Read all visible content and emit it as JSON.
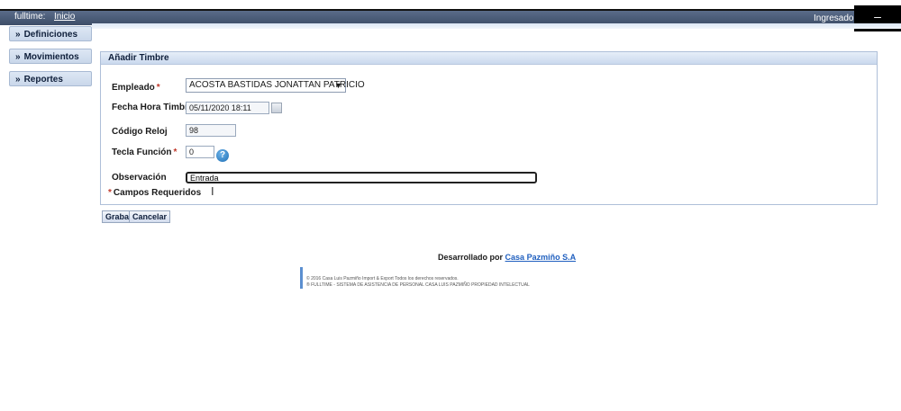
{
  "topbar": {
    "app_label": "fulltime:",
    "home_link": "Inicio",
    "logged_label": "Ingresado co",
    "overlay_glyph": "–"
  },
  "sidebar": {
    "items": [
      {
        "label": "Definiciones",
        "icon": "double-chevron-right-icon"
      },
      {
        "label": "Movimientos",
        "icon": "double-chevron-right-icon"
      },
      {
        "label": "Reportes",
        "icon": "double-chevron-right-icon"
      }
    ]
  },
  "form": {
    "title": "Añadir Timbre",
    "empleado_label": "Empleado",
    "empleado_value": "ACOSTA BASTIDAS JONATTAN PATRICIO",
    "fecha_label": "Fecha Hora Timbre",
    "fecha_value": "05/11/2020 18:11",
    "codigo_label": "Código Reloj",
    "codigo_value": "98",
    "tecla_label": "Tecla Función",
    "tecla_value": "0",
    "observacion_label": "Observación",
    "observacion_value": "Entrada",
    "required_marker": "*",
    "required_note": "Campos Requeridos",
    "help_glyph": "?",
    "cursor_glyph": "I"
  },
  "buttons": {
    "save": "Grabar",
    "cancel": "Cancelar"
  },
  "footer": {
    "developed_by": "Desarrollado por",
    "company_link": "Casa Pazmiño S.A",
    "copyright_line1": "© 2016 Casa Luis Pazmiño Import & Export    Todos los derechos reservados.",
    "copyright_line2": "® FULLTIME - SISTEMA DE ASISTENCIA DE PERSONAL CASA LUIS PAZMIÑO PROPIEDAD INTELECTUAL"
  },
  "colors": {
    "topbar": "#3d4d68",
    "panel_border": "#aebfd8",
    "link": "#1f5fbf",
    "required": "#c0392b"
  }
}
